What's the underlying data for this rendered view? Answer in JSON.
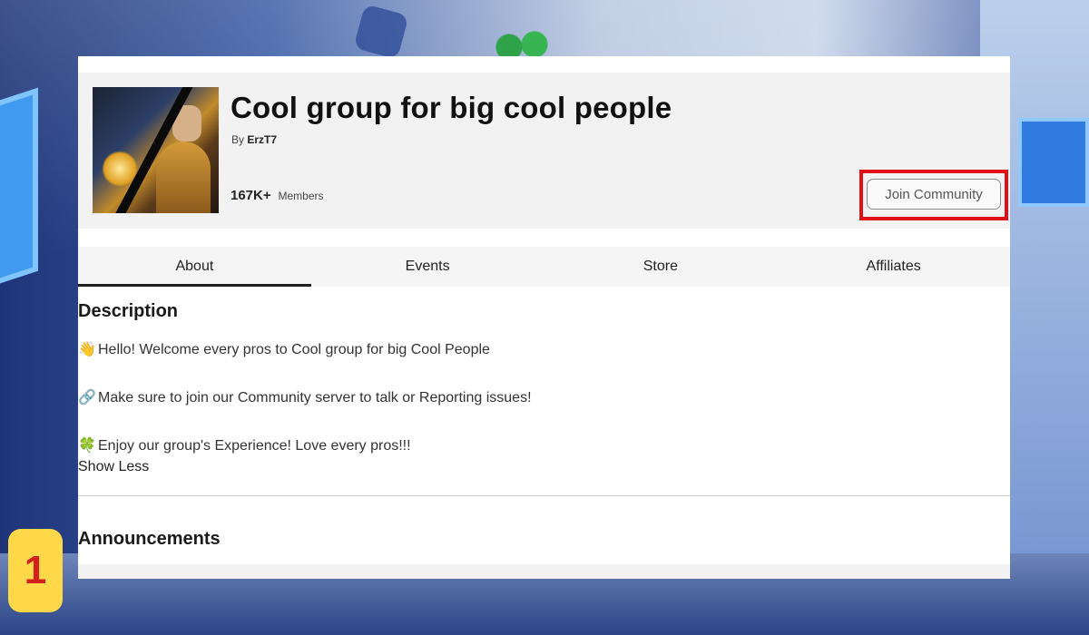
{
  "group": {
    "title": "Cool group for big cool people",
    "by_prefix": "By",
    "creator": "ErzT7",
    "member_count": "167K+",
    "members_label": "Members",
    "join_button": "Join Community"
  },
  "tabs": [
    {
      "label": "About",
      "active": true
    },
    {
      "label": "Events",
      "active": false
    },
    {
      "label": "Store",
      "active": false
    },
    {
      "label": "Affiliates",
      "active": false
    }
  ],
  "description": {
    "heading": "Description",
    "lines": [
      {
        "emoji": "👋",
        "text": "Hello! Welcome every pros to Cool group for big Cool People"
      },
      {
        "emoji": "🔗",
        "text": "Make sure to join our Community server to talk or Reporting issues!"
      },
      {
        "emoji": "🍀",
        "text": "Enjoy our group's Experience! Love every pros!!!"
      }
    ],
    "show_less": "Show Less"
  },
  "announcements": {
    "heading": "Announcements"
  },
  "step_badge": "1",
  "colors": {
    "highlight": "#e10f16",
    "badge_bg": "#ffd84a",
    "badge_text": "#d41f1f"
  }
}
